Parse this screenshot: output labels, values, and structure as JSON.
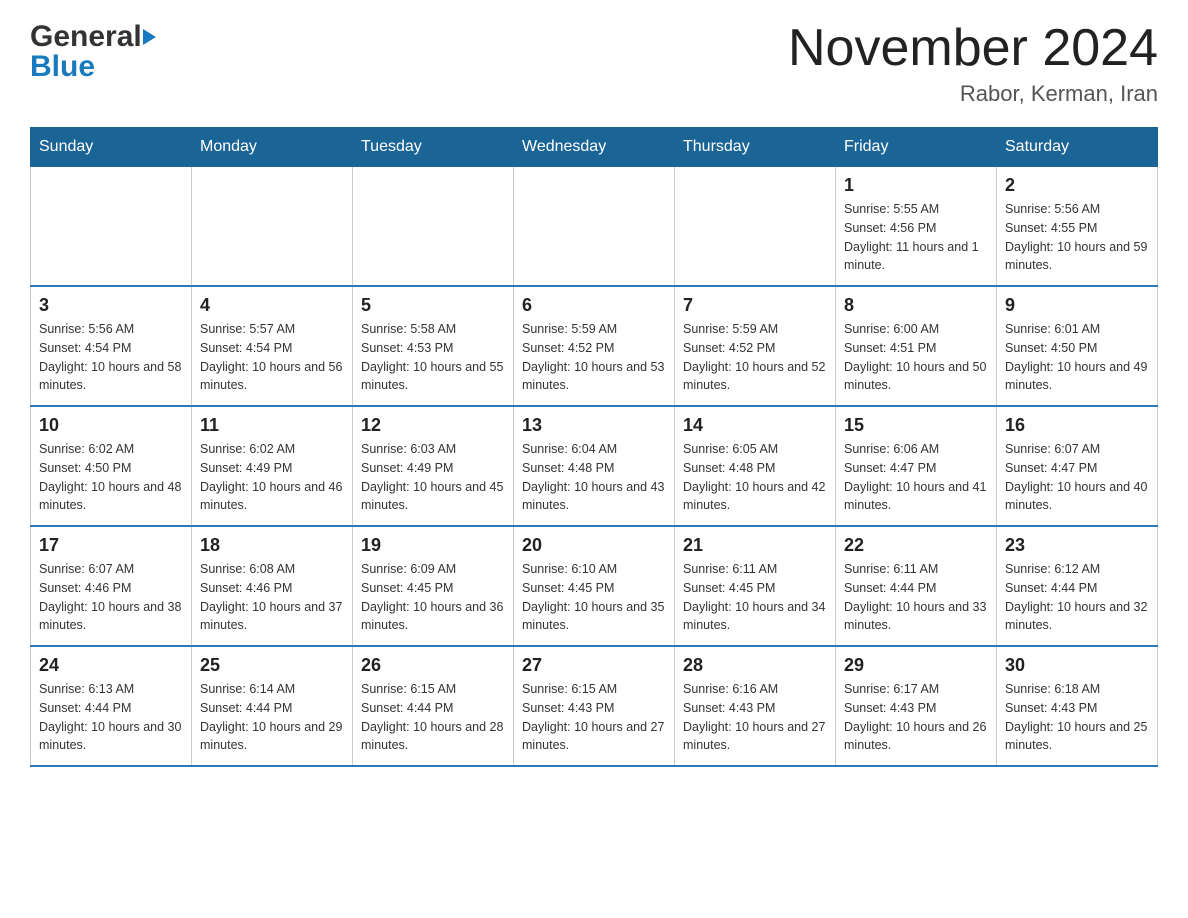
{
  "header": {
    "logo_line1": "General",
    "logo_line2": "Blue",
    "month_title": "November 2024",
    "location": "Rabor, Kerman, Iran"
  },
  "calendar": {
    "weekdays": [
      "Sunday",
      "Monday",
      "Tuesday",
      "Wednesday",
      "Thursday",
      "Friday",
      "Saturday"
    ],
    "rows": [
      [
        {
          "day": "",
          "info": ""
        },
        {
          "day": "",
          "info": ""
        },
        {
          "day": "",
          "info": ""
        },
        {
          "day": "",
          "info": ""
        },
        {
          "day": "",
          "info": ""
        },
        {
          "day": "1",
          "info": "Sunrise: 5:55 AM\nSunset: 4:56 PM\nDaylight: 11 hours and 1 minute."
        },
        {
          "day": "2",
          "info": "Sunrise: 5:56 AM\nSunset: 4:55 PM\nDaylight: 10 hours and 59 minutes."
        }
      ],
      [
        {
          "day": "3",
          "info": "Sunrise: 5:56 AM\nSunset: 4:54 PM\nDaylight: 10 hours and 58 minutes."
        },
        {
          "day": "4",
          "info": "Sunrise: 5:57 AM\nSunset: 4:54 PM\nDaylight: 10 hours and 56 minutes."
        },
        {
          "day": "5",
          "info": "Sunrise: 5:58 AM\nSunset: 4:53 PM\nDaylight: 10 hours and 55 minutes."
        },
        {
          "day": "6",
          "info": "Sunrise: 5:59 AM\nSunset: 4:52 PM\nDaylight: 10 hours and 53 minutes."
        },
        {
          "day": "7",
          "info": "Sunrise: 5:59 AM\nSunset: 4:52 PM\nDaylight: 10 hours and 52 minutes."
        },
        {
          "day": "8",
          "info": "Sunrise: 6:00 AM\nSunset: 4:51 PM\nDaylight: 10 hours and 50 minutes."
        },
        {
          "day": "9",
          "info": "Sunrise: 6:01 AM\nSunset: 4:50 PM\nDaylight: 10 hours and 49 minutes."
        }
      ],
      [
        {
          "day": "10",
          "info": "Sunrise: 6:02 AM\nSunset: 4:50 PM\nDaylight: 10 hours and 48 minutes."
        },
        {
          "day": "11",
          "info": "Sunrise: 6:02 AM\nSunset: 4:49 PM\nDaylight: 10 hours and 46 minutes."
        },
        {
          "day": "12",
          "info": "Sunrise: 6:03 AM\nSunset: 4:49 PM\nDaylight: 10 hours and 45 minutes."
        },
        {
          "day": "13",
          "info": "Sunrise: 6:04 AM\nSunset: 4:48 PM\nDaylight: 10 hours and 43 minutes."
        },
        {
          "day": "14",
          "info": "Sunrise: 6:05 AM\nSunset: 4:48 PM\nDaylight: 10 hours and 42 minutes."
        },
        {
          "day": "15",
          "info": "Sunrise: 6:06 AM\nSunset: 4:47 PM\nDaylight: 10 hours and 41 minutes."
        },
        {
          "day": "16",
          "info": "Sunrise: 6:07 AM\nSunset: 4:47 PM\nDaylight: 10 hours and 40 minutes."
        }
      ],
      [
        {
          "day": "17",
          "info": "Sunrise: 6:07 AM\nSunset: 4:46 PM\nDaylight: 10 hours and 38 minutes."
        },
        {
          "day": "18",
          "info": "Sunrise: 6:08 AM\nSunset: 4:46 PM\nDaylight: 10 hours and 37 minutes."
        },
        {
          "day": "19",
          "info": "Sunrise: 6:09 AM\nSunset: 4:45 PM\nDaylight: 10 hours and 36 minutes."
        },
        {
          "day": "20",
          "info": "Sunrise: 6:10 AM\nSunset: 4:45 PM\nDaylight: 10 hours and 35 minutes."
        },
        {
          "day": "21",
          "info": "Sunrise: 6:11 AM\nSunset: 4:45 PM\nDaylight: 10 hours and 34 minutes."
        },
        {
          "day": "22",
          "info": "Sunrise: 6:11 AM\nSunset: 4:44 PM\nDaylight: 10 hours and 33 minutes."
        },
        {
          "day": "23",
          "info": "Sunrise: 6:12 AM\nSunset: 4:44 PM\nDaylight: 10 hours and 32 minutes."
        }
      ],
      [
        {
          "day": "24",
          "info": "Sunrise: 6:13 AM\nSunset: 4:44 PM\nDaylight: 10 hours and 30 minutes."
        },
        {
          "day": "25",
          "info": "Sunrise: 6:14 AM\nSunset: 4:44 PM\nDaylight: 10 hours and 29 minutes."
        },
        {
          "day": "26",
          "info": "Sunrise: 6:15 AM\nSunset: 4:44 PM\nDaylight: 10 hours and 28 minutes."
        },
        {
          "day": "27",
          "info": "Sunrise: 6:15 AM\nSunset: 4:43 PM\nDaylight: 10 hours and 27 minutes."
        },
        {
          "day": "28",
          "info": "Sunrise: 6:16 AM\nSunset: 4:43 PM\nDaylight: 10 hours and 27 minutes."
        },
        {
          "day": "29",
          "info": "Sunrise: 6:17 AM\nSunset: 4:43 PM\nDaylight: 10 hours and 26 minutes."
        },
        {
          "day": "30",
          "info": "Sunrise: 6:18 AM\nSunset: 4:43 PM\nDaylight: 10 hours and 25 minutes."
        }
      ]
    ]
  }
}
